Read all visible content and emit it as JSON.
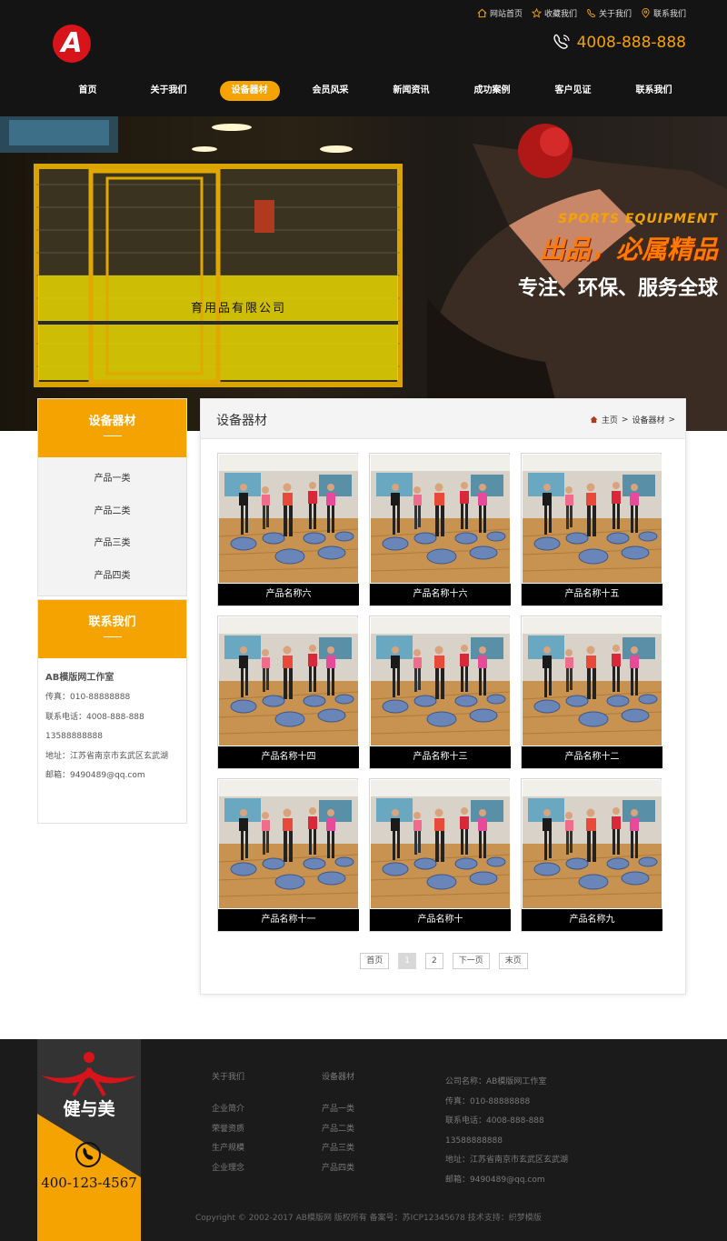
{
  "header": {
    "logo_text": "A",
    "top_links": [
      {
        "label": "网站首页",
        "icon": "home-icon"
      },
      {
        "label": "收藏我们",
        "icon": "star-icon"
      },
      {
        "label": "关于我们",
        "icon": "phone-icon"
      },
      {
        "label": "联系我们",
        "icon": "location-icon"
      }
    ],
    "hotline": "4008-888-888",
    "accent": "#f5a300"
  },
  "nav": {
    "items": [
      "首页",
      "关于我们",
      "设备器材",
      "会员风采",
      "新闻资讯",
      "成功案例",
      "客户见证",
      "联系我们"
    ],
    "active_index": 2
  },
  "banner": {
    "sign": "育用品有限公司",
    "english": "SPORTS EQUIPMENT",
    "title": "出品，必属精品",
    "subtitle": "专注、环保、服务全球"
  },
  "sidebar": {
    "category_title": "设备器材",
    "categories": [
      "产品一类",
      "产品二类",
      "产品三类",
      "产品四类"
    ],
    "contact_title": "联系我们",
    "contact": {
      "name": "AB模版网工作室",
      "fax": "传真：010-88888888",
      "phone": "联系电话：4008-888-888",
      "mobile": "13588888888",
      "address": "地址：江苏省南京市玄武区玄武湖",
      "email": "邮箱：9490489@qq.com"
    }
  },
  "main": {
    "title": "设备器材",
    "breadcrumb": {
      "home": "主页",
      "sep": ">",
      "current": "设备器材",
      "trail": ">"
    },
    "products": [
      "产品名称六",
      "产品名称十六",
      "产品名称十五",
      "产品名称十四",
      "产品名称十三",
      "产品名称十二",
      "产品名称十一",
      "产品名称十",
      "产品名称九"
    ],
    "pager": {
      "first": "首页",
      "pages": [
        "1",
        "2"
      ],
      "current": "1",
      "next": "下一页",
      "last": "末页"
    }
  },
  "footer": {
    "brand": "健与美",
    "tel": "400-123-4567",
    "col1": {
      "title": "关于我们",
      "links": [
        "企业简介",
        "荣誉资质",
        "生产规模",
        "企业理念"
      ]
    },
    "col2": {
      "title": "设备器材",
      "links": [
        "产品一类",
        "产品二类",
        "产品三类",
        "产品四类"
      ]
    },
    "info": {
      "company": "公司名称：AB模版网工作室",
      "fax": "传真：010-88888888",
      "phone": "联系电话：4008-888-888",
      "mobile": "13588888888",
      "address": "地址：江苏省南京市玄武区玄武湖",
      "email": "邮箱：9490489@qq.com"
    },
    "copyright": "Copyright © 2002-2017 AB模版网 版权所有 备案号：苏ICP12345678 技术支持：织梦模版"
  }
}
